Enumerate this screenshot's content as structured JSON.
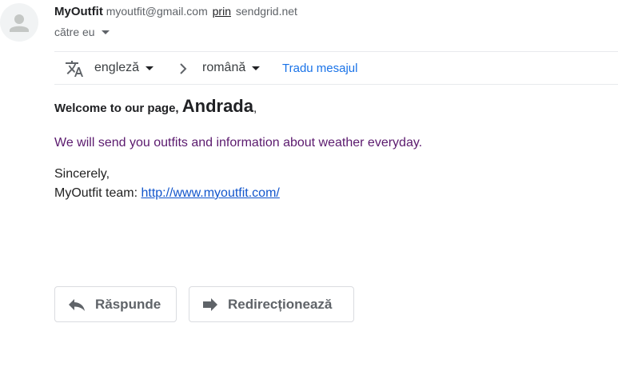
{
  "sender": {
    "name": "MyOutfit",
    "email": "myoutfit@gmail.com",
    "via_label": "prin",
    "via_domain": "sendgrid.net"
  },
  "recipient": {
    "label": "către eu"
  },
  "translate": {
    "source_lang": "engleză",
    "target_lang": "română",
    "action_label": "Tradu mesajul"
  },
  "message": {
    "greeting_prefix": "Welcome to our page, ",
    "greeting_name": "Andrada",
    "greeting_suffix": ",",
    "body": "We will send you outfits and information about weather everyday.",
    "signature_line1": "Sincerely,",
    "signature_team": "MyOutfit team: ",
    "signature_link": "http://www.myoutfit.com/"
  },
  "actions": {
    "reply_label": "Răspunde",
    "forward_label": "Redirecționează"
  },
  "icons": {
    "avatar": "person-icon",
    "translate": "translate-icon",
    "reply": "reply-icon",
    "forward": "forward-icon"
  },
  "colors": {
    "link": "#1a73e8",
    "body_text": "#5b1a6e",
    "muted": "#5f6368"
  }
}
